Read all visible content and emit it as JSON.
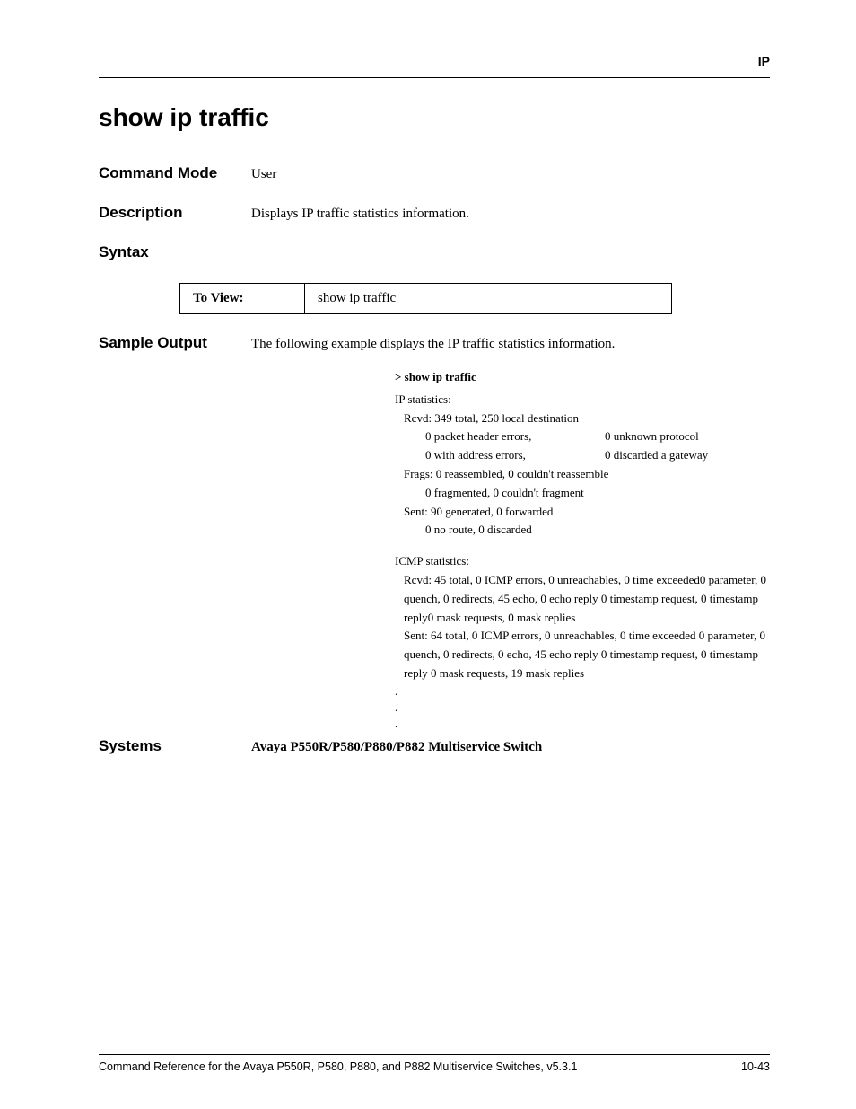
{
  "chapter_label": "IP",
  "title": "show ip traffic",
  "command_mode": {
    "label": "Command Mode",
    "value": "User"
  },
  "description": {
    "label": "Description",
    "value": "Displays IP traffic statistics information."
  },
  "syntax": {
    "label": "Syntax",
    "table": {
      "left": "To View:",
      "right": "show ip traffic"
    }
  },
  "sample_output": {
    "label": "Sample Output",
    "intro": "The following example displays the IP traffic statistics information.",
    "prompt": "> show ip traffic",
    "lines": {
      "ip_header": "IP statistics:",
      "rcvd": "Rcvd:  349 total, 250 local destination",
      "pkt_hdr_err": "0 packet header errors,",
      "unknown_proto": "0 unknown protocol",
      "addr_err": "0 with address errors,",
      "disc_gateway": "0 discarded a gateway",
      "frags": "Frags:  0 reassembled, 0 couldn't reassemble",
      "frag2": "0 fragmented, 0 couldn't fragment",
      "sent": "Sent:  90 generated, 0 forwarded",
      "sent2": "0 no route, 0 discarded",
      "icmp_header": "ICMP statistics:",
      "icmp_rcvd": "Rcvd:  45 total, 0 ICMP errors, 0 unreachables, 0 time exceeded0 parameter, 0 quench, 0 redirects, 45 echo, 0 echo reply 0 timestamp request, 0 timestamp reply0 mask requests, 0 mask replies",
      "icmp_sent": "Sent:  64 total, 0 ICMP errors, 0 unreachables, 0 time exceeded 0 parameter, 0 quench, 0 redirects, 0 echo, 45 echo reply 0 timestamp request, 0 timestamp reply 0 mask requests, 19 mask replies",
      "dot": "."
    }
  },
  "systems": {
    "label": "Systems",
    "value": "Avaya P550R/P580/P880/P882 Multiservice Switch"
  },
  "footer": {
    "left": "Command Reference for the Avaya P550R, P580, P880, and P882 Multiservice Switches, v5.3.1",
    "right": "10-43"
  }
}
